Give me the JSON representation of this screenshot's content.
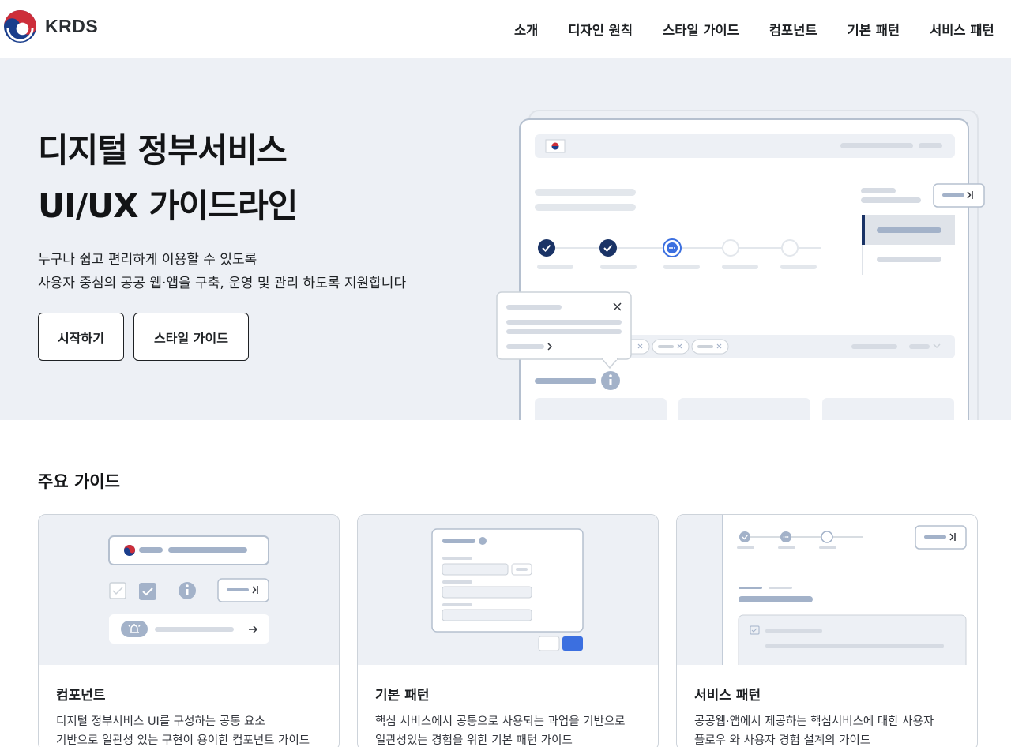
{
  "header": {
    "logo_text": "KRDS",
    "nav": [
      {
        "label": "소개"
      },
      {
        "label": "디자인 원칙"
      },
      {
        "label": "스타일 가이드"
      },
      {
        "label": "컴포넌트"
      },
      {
        "label": "기본 패턴"
      },
      {
        "label": "서비스 패턴"
      }
    ]
  },
  "hero": {
    "title_line1": "디지털 정부서비스",
    "title_line2": "UI/UX 가이드라인",
    "desc_line1": "누구나 쉽고 편리하게 이용할 수 있도록",
    "desc_line2": "사용자 중심의 공공 웹·앱을 구축, 운영 및 관리 하도록 지원합니다",
    "btn_start": "시작하기",
    "btn_style": "스타일 가이드"
  },
  "guides": {
    "title": "주요 가이드",
    "cards": [
      {
        "title": "컴포넌트",
        "desc_line1": "디지털 정부서비스 UI를 구성하는 공통 요소",
        "desc_line2": "기반으로 일관성 있는 구현이 용이한 컴포넌트 가이드"
      },
      {
        "title": "기본 패턴",
        "desc_line1": "핵심 서비스에서 공통으로 사용되는 과업을 기반으로",
        "desc_line2": "일관성있는 경험을 위한 기본 패턴 가이드"
      },
      {
        "title": "서비스 패턴",
        "desc_line1": "공공웹·앱에서 제공하는 핵심서비스에 대한 사용자",
        "desc_line2": "플로우 와 사용자 경험 설계의 가이드"
      }
    ]
  },
  "colors": {
    "hero_bg": "#edf0f5",
    "navy": "#1a3366",
    "accent_blue": "#3b6fe0",
    "placeholder": "#d6dbe3",
    "placeholder_dark": "#a3b2c9"
  }
}
